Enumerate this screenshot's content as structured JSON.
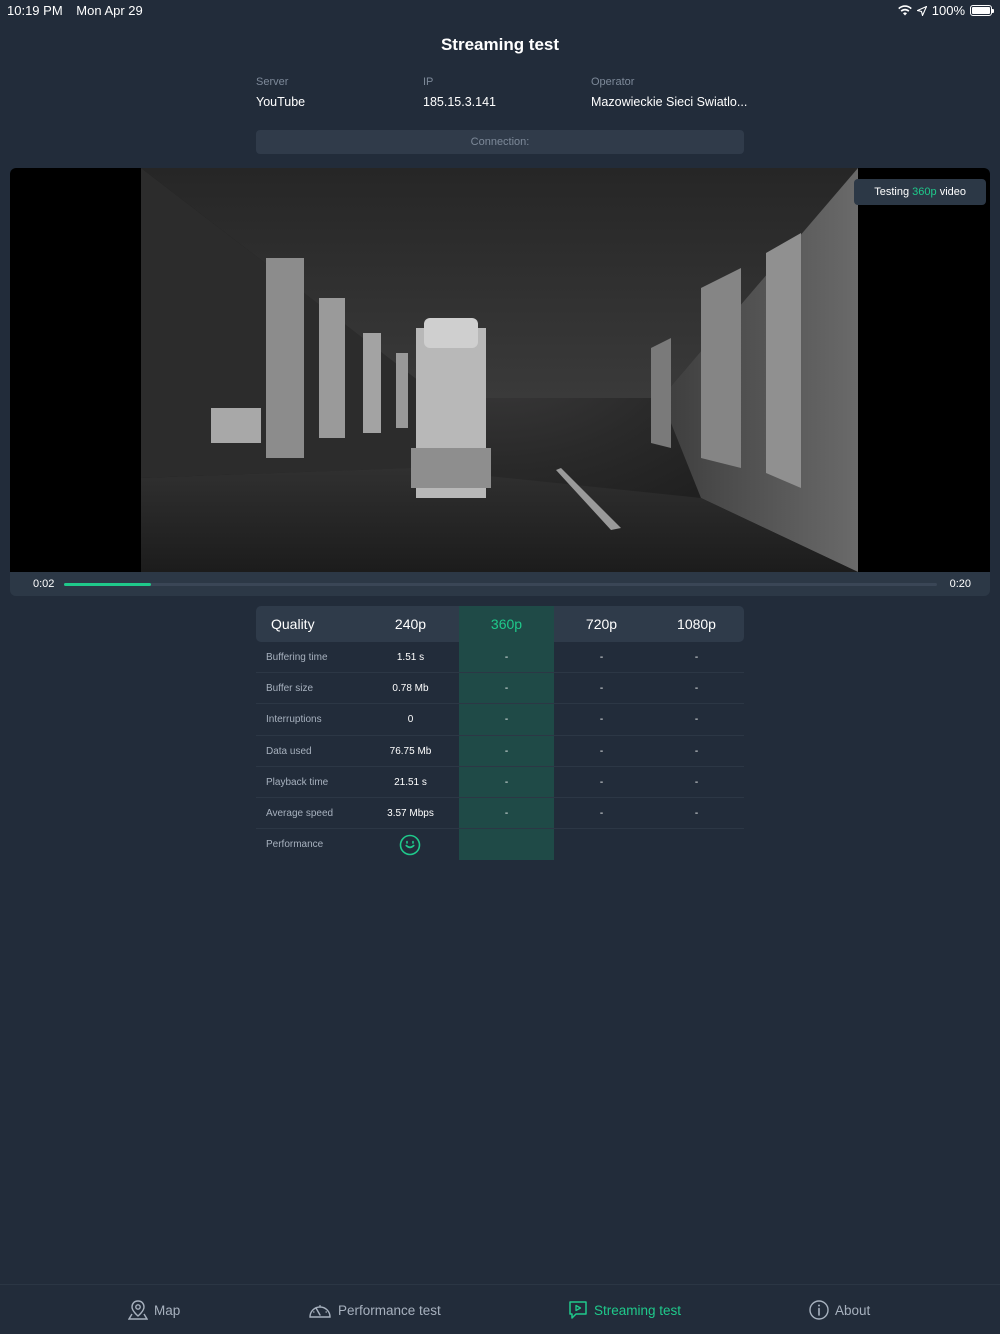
{
  "status_bar": {
    "time": "10:19 PM",
    "date": "Mon Apr 29",
    "battery": "100%",
    "icons": [
      "wifi-icon",
      "location-icon",
      "battery-icon"
    ]
  },
  "header": {
    "title": "Streaming test"
  },
  "info": {
    "server_label": "Server",
    "server_value": "YouTube",
    "ip_label": "IP",
    "ip_value": "185.15.3.141",
    "operator_label": "Operator",
    "operator_value": "Mazowieckie Sieci Swiatlo..."
  },
  "connection": {
    "label": "Connection:"
  },
  "player": {
    "badge_prefix": "Testing",
    "badge_quality": "360p",
    "badge_suffix": "video",
    "current_time": "0:02",
    "total_time": "0:20",
    "progress": 0.1
  },
  "quality_table": {
    "header_label": "Quality",
    "columns": [
      "240p",
      "360p",
      "720p",
      "1080p"
    ],
    "active_column": "360p",
    "rows": [
      {
        "label": "Buffering time",
        "values": [
          "1.51 s",
          "-",
          "-",
          "-"
        ]
      },
      {
        "label": "Buffer size",
        "values": [
          "0.78 Mb",
          "-",
          "-",
          "-"
        ]
      },
      {
        "label": "Interruptions",
        "values": [
          "0",
          "-",
          "-",
          "-"
        ]
      },
      {
        "label": "Data used",
        "values": [
          "76.75 Mb",
          "-",
          "-",
          "-"
        ]
      },
      {
        "label": "Playback time",
        "values": [
          "21.51 s",
          "-",
          "-",
          "-"
        ]
      },
      {
        "label": "Average speed",
        "values": [
          "3.57 Mbps",
          "-",
          "-",
          "-"
        ]
      }
    ],
    "performance_label": "Performance",
    "performance_icon": "smiley-icon"
  },
  "tabs": [
    {
      "label": "Map",
      "icon": "map-pin-icon"
    },
    {
      "label": "Performance test",
      "icon": "speedometer-icon"
    },
    {
      "label": "Streaming test",
      "icon": "play-screen-icon"
    },
    {
      "label": "About",
      "icon": "info-icon"
    }
  ],
  "colors": {
    "background": "#222c3a",
    "accent": "#1fc98b",
    "panel": "#2f3b4a"
  }
}
